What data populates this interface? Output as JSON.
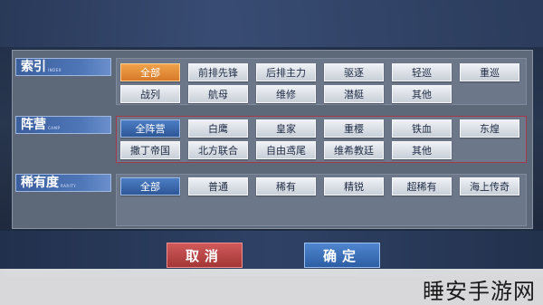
{
  "sections": {
    "index": {
      "title": "索引",
      "subtitle": "INDEX",
      "options": [
        "全部",
        "前排先锋",
        "后排主力",
        "驱逐",
        "轻巡",
        "重巡",
        "战列",
        "航母",
        "维修",
        "潜艇",
        "其他"
      ]
    },
    "camp": {
      "title": "阵营",
      "subtitle": "CAMP",
      "options": [
        "全阵营",
        "白鹰",
        "皇家",
        "重樱",
        "铁血",
        "东煌",
        "撒丁帝国",
        "北方联合",
        "自由鸢尾",
        "维希教廷",
        "其他"
      ]
    },
    "rarity": {
      "title": "稀有度",
      "subtitle": "RARITY",
      "options": [
        "全部",
        "普通",
        "稀有",
        "精锐",
        "超稀有",
        "海上传奇"
      ]
    }
  },
  "actions": {
    "cancel": "取消",
    "confirm": "确定"
  },
  "watermark": "睡安手游网",
  "colors": {
    "selected_index": "#d7792a",
    "selected_other": "#2d5796",
    "cancel": "#a33636",
    "confirm": "#2d5ea4"
  }
}
